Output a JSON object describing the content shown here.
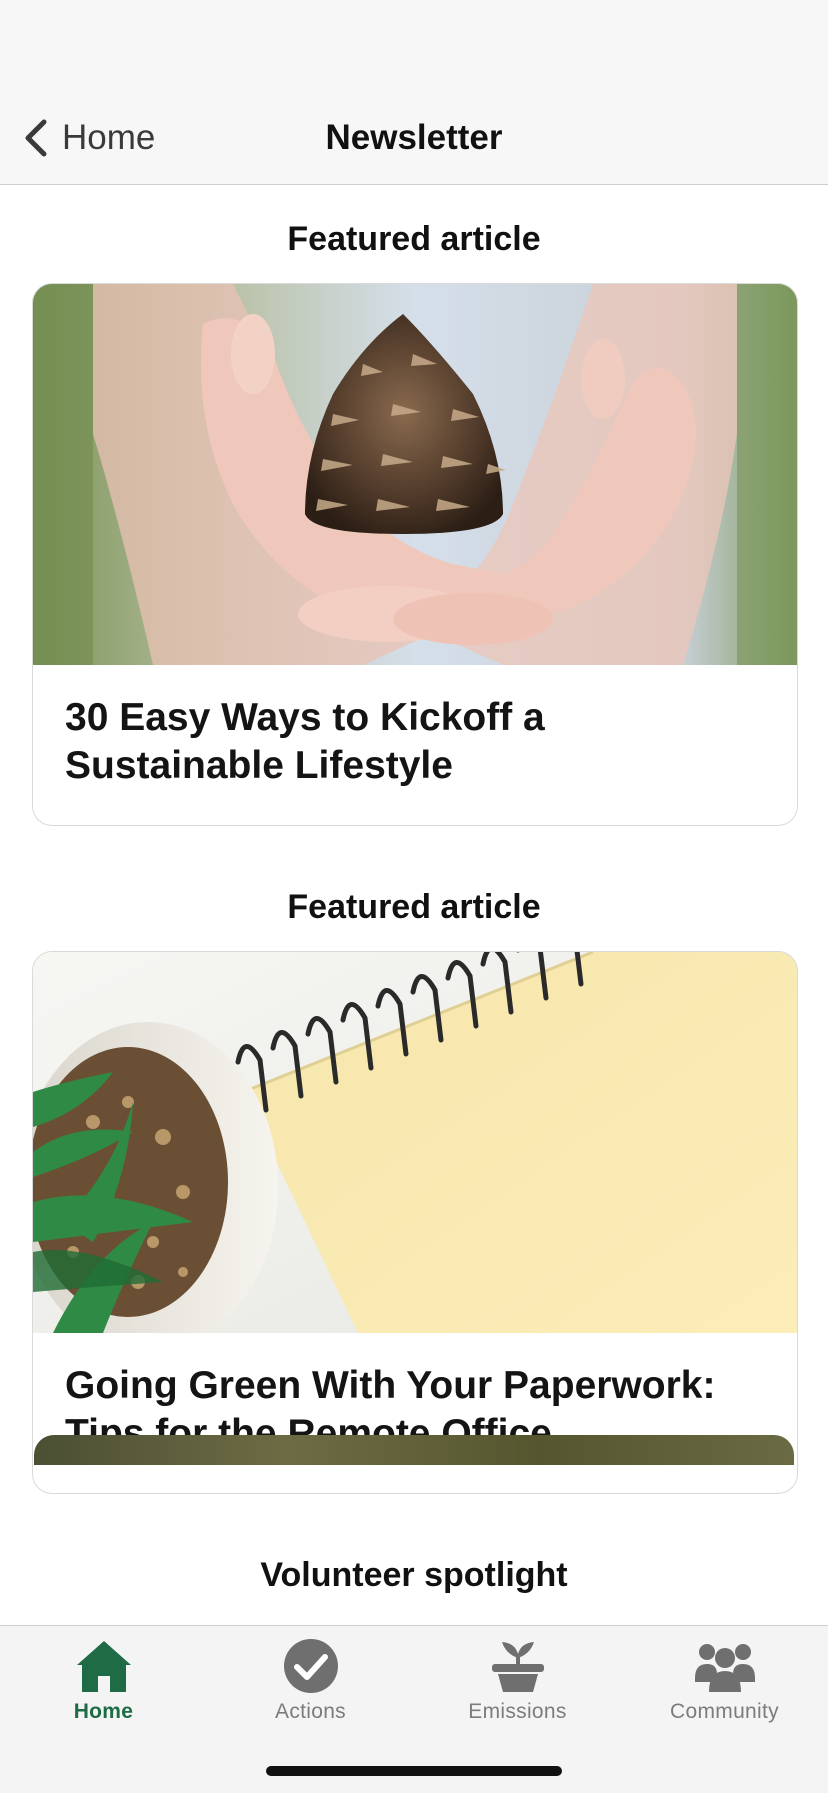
{
  "nav": {
    "back_label": "Home",
    "title": "Newsletter"
  },
  "sections": [
    {
      "heading": "Featured article",
      "article_title": "30 Easy Ways to Kickoff a Sustainable Lifestyle",
      "image": "hands-holding-pinecone"
    },
    {
      "heading": "Featured article",
      "article_title": "Going Green With Your Paperwork: Tips for the Remote Office",
      "image": "notepad-and-succulent"
    },
    {
      "heading": "Volunteer spotlight"
    }
  ],
  "tabs": [
    {
      "label": "Home",
      "icon": "home-icon",
      "active": true
    },
    {
      "label": "Actions",
      "icon": "checkmark-circle-icon",
      "active": false
    },
    {
      "label": "Emissions",
      "icon": "plant-pot-icon",
      "active": false
    },
    {
      "label": "Community",
      "icon": "people-group-icon",
      "active": false
    }
  ],
  "colors": {
    "accent": "#1e6b45",
    "inactive_tab": "#7c7c7c"
  }
}
